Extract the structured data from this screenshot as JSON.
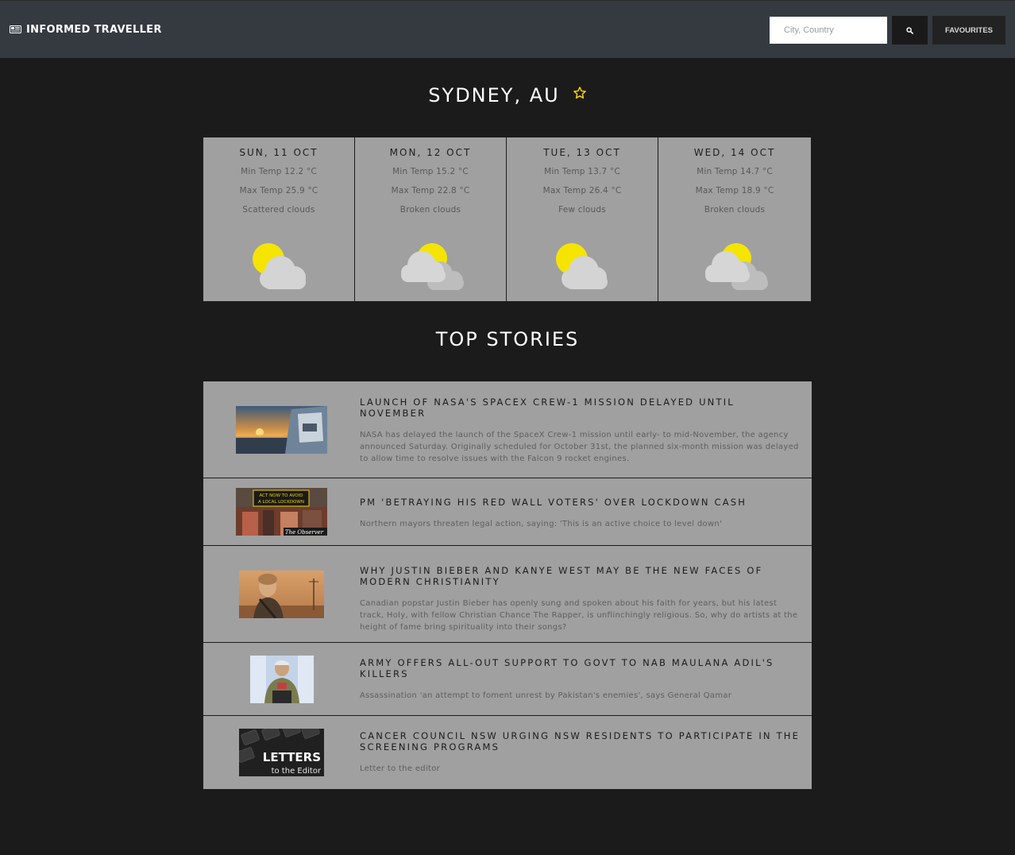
{
  "header": {
    "brand_icon": "newspaper-icon",
    "brand": "INFORMED TRAVELLER",
    "search_placeholder": "City, Country",
    "search_icon": "search-icon",
    "favourites_label": "FAVOURITES"
  },
  "location": {
    "title": "SYDNEY, AU",
    "favourite_icon": "star-outline-icon",
    "star_color": "#f5d000"
  },
  "forecast": [
    {
      "date": "SUN, 11 OCT",
      "min": "Min Temp 12.2 °C",
      "max": "Max Temp 25.9 °C",
      "desc": "Scattered clouds",
      "icon": "sun-behind-cloud-icon"
    },
    {
      "date": "MON, 12 OCT",
      "min": "Min Temp 15.2 °C",
      "max": "Max Temp 22.8 °C",
      "desc": "Broken clouds",
      "icon": "broken-clouds-icon"
    },
    {
      "date": "TUE, 13 OCT",
      "min": "Min Temp 13.7 °C",
      "max": "Max Temp 26.4 °C",
      "desc": "Few clouds",
      "icon": "sun-behind-cloud-icon"
    },
    {
      "date": "WED, 14 OCT",
      "min": "Min Temp 14.7 °C",
      "max": "Max Temp 18.9 °C",
      "desc": "Broken clouds",
      "icon": "broken-clouds-icon"
    }
  ],
  "stories_heading": "TOP STORIES",
  "stories": [
    {
      "title": "LAUNCH OF NASA'S SPACEX CREW-1 MISSION DELAYED UNTIL NOVEMBER",
      "desc": "NASA has delayed the launch of the SpaceX Crew-1 mission until early- to mid-November, the agency announced Saturday. Originally scheduled for October 31st, the planned six-month mission was delayed to allow time to resolve issues with the Falcon 9 rocket engines.",
      "thumb": "sunset-capsule-photo"
    },
    {
      "title": "PM 'BETRAYING HIS RED WALL VOTERS' OVER LOCKDOWN CASH",
      "desc": "Northern mayors threaten legal action, saying: 'This is an active choice to level down'",
      "thumb": "street-sign-photo",
      "thumb_caption": "The Observer",
      "thumb_sign": "ACT NOW TO AVOID A LOCAL LOCKDOWN"
    },
    {
      "title": "WHY JUSTIN BIEBER AND KANYE WEST MAY BE THE NEW FACES OF MODERN CHRISTIANITY",
      "desc": "Canadian popstar Justin Bieber has openly sung and spoken about his faith for years, but his latest track, Holy, with fellow Christian Chance The Rapper, is unflinchingly religious. So, why do artists at the height of fame bring spirituality into their songs?",
      "thumb": "singer-portrait-photo"
    },
    {
      "title": "ARMY OFFERS ALL-OUT SUPPORT TO GOVT TO NAB MAULANA ADIL'S KILLERS",
      "desc": "Assassination 'an attempt to foment unrest by Pakistan's enemies', says General Qamar",
      "thumb": "general-portrait-photo"
    },
    {
      "title": "CANCER COUNCIL NSW URGING NSW RESIDENTS TO PARTICIPATE IN THE SCREENING PROGRAMS",
      "desc": "Letter to the editor",
      "thumb": "letters-keyboard-photo",
      "thumb_caption": "LETTERS",
      "thumb_sub": "to the Editor"
    }
  ]
}
